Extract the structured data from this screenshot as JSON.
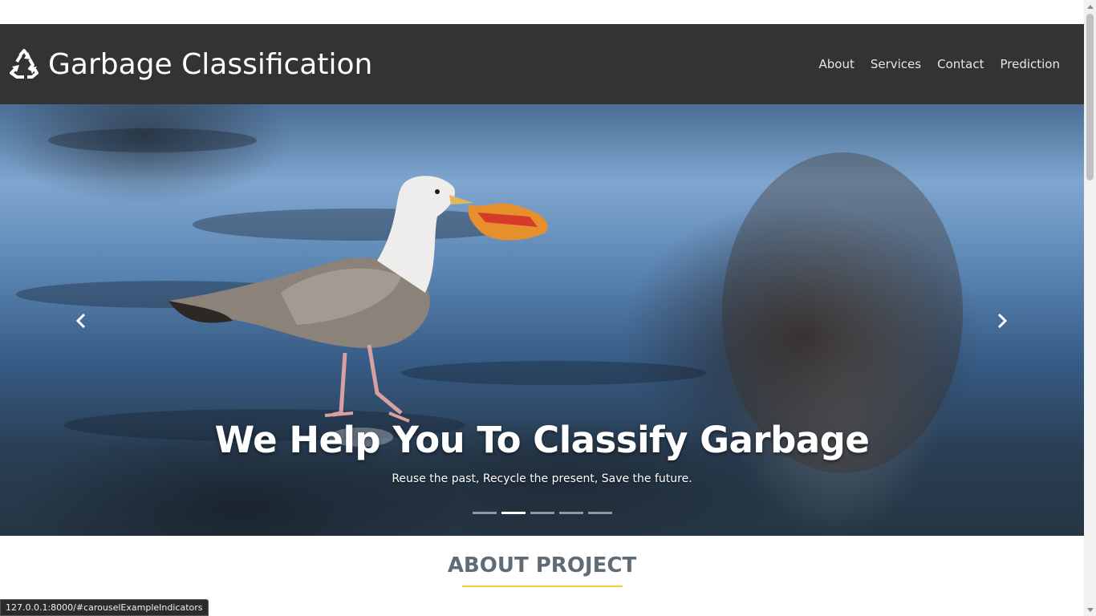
{
  "navbar": {
    "brand_icon": "recycle-icon",
    "brand_title": "Garbage Classification",
    "links": [
      {
        "label": "About"
      },
      {
        "label": "Services"
      },
      {
        "label": "Contact"
      },
      {
        "label": "Prediction"
      }
    ],
    "background": "#333333"
  },
  "hero": {
    "title": "We Help You To Classify Garbage",
    "subtitle": "Reuse the past, Recycle the present, Save the future.",
    "prev_icon": "chevron-left-icon",
    "next_icon": "chevron-right-icon",
    "slide_count": 5,
    "active_slide": 2
  },
  "about": {
    "title": "ABOUT PROJECT",
    "accent": "#f2cf2a"
  },
  "status_bar": {
    "url": "127.0.0.1:8000/#carouselExampleIndicators"
  }
}
